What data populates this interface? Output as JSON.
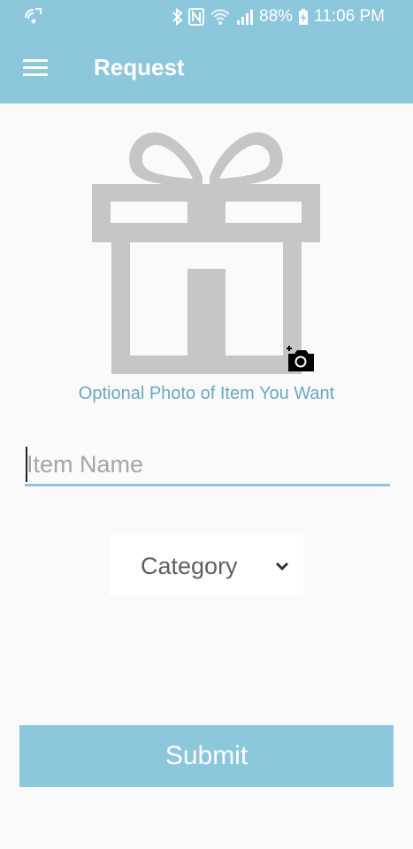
{
  "status_bar": {
    "battery": "88%",
    "time": "11:06 PM",
    "icons": [
      "wifi-call-icon",
      "bluetooth-icon",
      "nfc-icon",
      "wifi-icon",
      "signal-icon",
      "battery-charging-icon"
    ]
  },
  "app_bar": {
    "title": "Request",
    "menu_icon": "hamburger-menu-icon"
  },
  "photo": {
    "placeholder_icon": "gift-icon",
    "add_photo_icon": "add-camera-icon",
    "caption": "Optional Photo of Item You Want"
  },
  "item_name": {
    "placeholder": "Item Name",
    "value": ""
  },
  "category": {
    "selected": "Category",
    "icon": "chevron-down-icon"
  },
  "submit": {
    "label": "Submit"
  },
  "colors": {
    "primary": "#8cc7dc",
    "caption_text": "#6aa8bf",
    "placeholder_icon": "#c6c6c6",
    "background": "#fafafa"
  }
}
